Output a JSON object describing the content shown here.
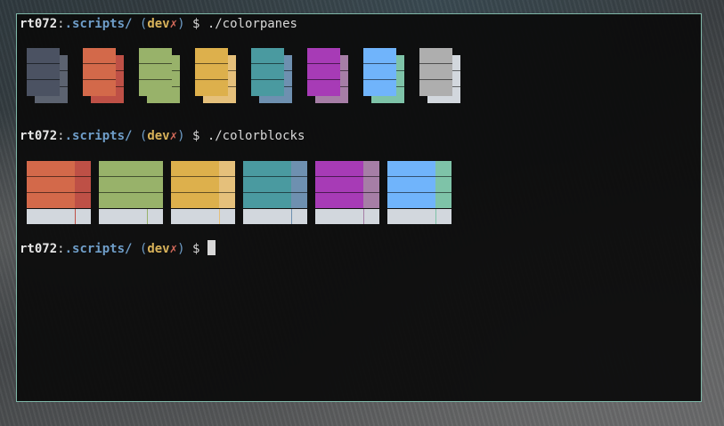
{
  "prompt": {
    "user": "rt072",
    "colon": ":",
    "dir": ".scripts/",
    "paren_open": "(",
    "branch": "dev",
    "dirty": "✗",
    "paren_close": ")",
    "dollar": "$"
  },
  "lines": [
    {
      "command": "./colorpanes"
    },
    {
      "command": "./colorblocks"
    },
    {
      "command": ""
    }
  ],
  "colors": {
    "terminal_bg": "#0c0c0c",
    "border": "#7fb7a8",
    "user": "#e6e6e6",
    "dir": "#6f9ec9",
    "branch": "#d8b25a",
    "dirty": "#d46a5a"
  },
  "colorpanes": [
    {
      "name": "black",
      "front": "#4b5262",
      "back": "#5c6370"
    },
    {
      "name": "red",
      "front": "#d3694a",
      "back": "#be5046"
    },
    {
      "name": "green",
      "front": "#98b26a",
      "back": "#98b26a"
    },
    {
      "name": "yellow",
      "front": "#ddb04c",
      "back": "#e5c07b"
    },
    {
      "name": "teal",
      "front": "#4a9aa0",
      "back": "#6e90b0"
    },
    {
      "name": "magenta",
      "front": "#a73bb6",
      "back": "#a67ea6"
    },
    {
      "name": "blue",
      "front": "#70b4fb",
      "back": "#7ec3a8"
    },
    {
      "name": "white",
      "front": "#aeaeae",
      "back": "#d2d7dd"
    }
  ],
  "colorblocks": [
    {
      "name": "red",
      "main": "#d3694a",
      "side": "#be5046"
    },
    {
      "name": "green",
      "main": "#98b26a",
      "side": "#98b26a"
    },
    {
      "name": "yellow",
      "main": "#ddb04c",
      "side": "#e5c07b"
    },
    {
      "name": "teal",
      "main": "#4a9aa0",
      "side": "#6e90b0"
    },
    {
      "name": "magenta",
      "main": "#a73bb6",
      "side": "#a67ea6"
    },
    {
      "name": "blue",
      "main": "#70b4fb",
      "side": "#7ec3a8"
    }
  ]
}
